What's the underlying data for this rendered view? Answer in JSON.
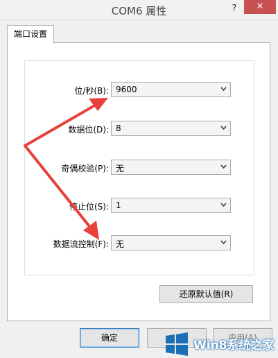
{
  "window": {
    "title": "COM6 属性",
    "help_glyph": "?",
    "close_glyph": "✕"
  },
  "tabs": [
    {
      "label": "端口设置",
      "active": true
    }
  ],
  "port_settings": {
    "fields": [
      {
        "label": "位/秒(B):",
        "value": "9600"
      },
      {
        "label": "数据位(D):",
        "value": "8"
      },
      {
        "label": "奇偶校验(P):",
        "value": "无"
      },
      {
        "label": "停止位(S):",
        "value": "1"
      },
      {
        "label": "数据流控制(F):",
        "value": "无"
      }
    ],
    "restore_defaults_label": "还原默认值(R)"
  },
  "buttons": {
    "ok_label": "确定",
    "cancel_label": "",
    "apply_label": "应用(A)"
  },
  "annotation": {
    "arrow_color": "#e8403a"
  },
  "watermark": {
    "text": "Win8系统之家",
    "logo": "windows-logo-icon"
  },
  "colors": {
    "accent": "#3c7fb1",
    "close": "#c75050",
    "watermark_blue": "#1a6fb5"
  }
}
